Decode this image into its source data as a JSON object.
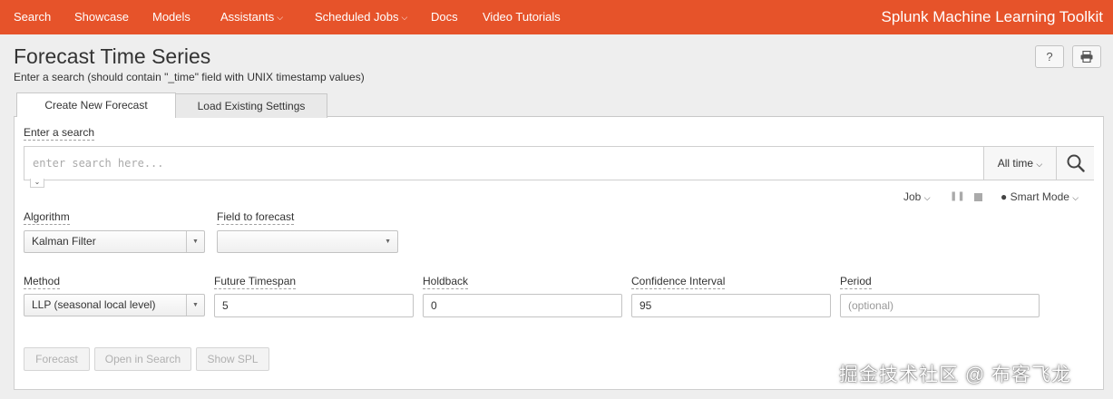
{
  "nav": {
    "items": [
      "Search",
      "Showcase",
      "Models"
    ],
    "assistants": "Assistants",
    "scheduled_jobs": "Scheduled Jobs",
    "docs": "Docs",
    "video_tutorials": "Video Tutorials",
    "brand": "Splunk Machine Learning Toolkit"
  },
  "header": {
    "title": "Forecast Time Series",
    "subtitle": "Enter a search (should contain \"_time\" field with UNIX timestamp values)",
    "help_label": "?"
  },
  "tabs": [
    "Create New Forecast",
    "Load Existing Settings"
  ],
  "search": {
    "label": "Enter a search",
    "placeholder": "enter search here...",
    "time_range": "All time"
  },
  "jobbar": {
    "job": "Job",
    "mode": "Smart Mode"
  },
  "form": {
    "algorithm_label": "Algorithm",
    "algorithm_value": "Kalman Filter",
    "field_label": "Field to forecast",
    "field_value": "",
    "method_label": "Method",
    "method_value": "LLP (seasonal local level)",
    "timespan_label": "Future Timespan",
    "timespan_value": "5",
    "holdback_label": "Holdback",
    "holdback_value": "0",
    "confidence_label": "Confidence Interval",
    "confidence_value": "95",
    "period_label": "Period",
    "period_placeholder": "(optional)"
  },
  "buttons": {
    "forecast": "Forecast",
    "open_in_search": "Open in Search",
    "show_spl": "Show SPL"
  },
  "watermark": "掘金技术社区 @ 布客飞龙",
  "colors": {
    "nav_background": "#e6532a"
  }
}
